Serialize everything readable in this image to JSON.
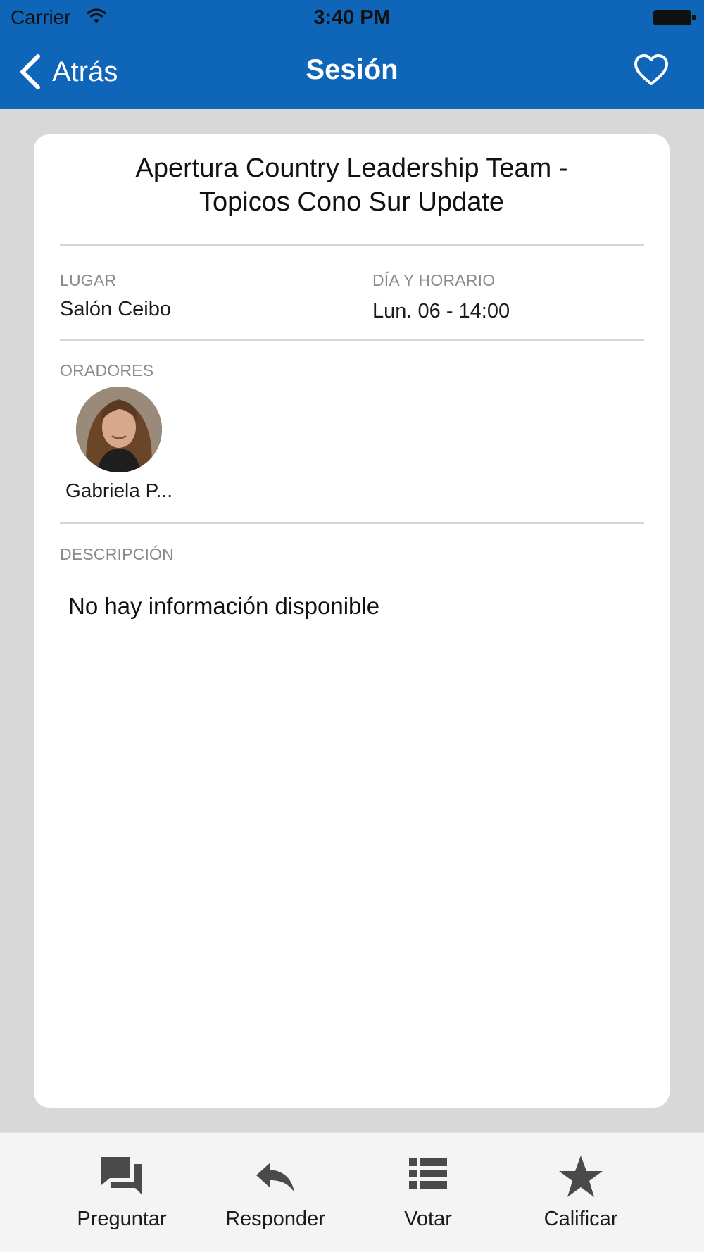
{
  "status_bar": {
    "carrier": "Carrier",
    "time": "3:40 PM"
  },
  "nav": {
    "back_label": "Atrás",
    "title": "Sesión"
  },
  "session": {
    "title_line1": "Apertura Country Leadership Team -",
    "title_line2": "Topicos Cono Sur Update",
    "location_label": "LUGAR",
    "location_value": "Salón Ceibo",
    "datetime_label": "DÍA Y HORARIO",
    "datetime_value": "Lun. 06 - 14:00",
    "speakers_label": "ORADORES",
    "speakers": [
      {
        "name": "Gabriela P..."
      }
    ],
    "description_label": "DESCRIPCIÓN",
    "description_value": "No hay información disponible"
  },
  "tabbar": {
    "tabs": [
      {
        "label": "Preguntar",
        "icon": "chat-bubbles-icon"
      },
      {
        "label": "Responder",
        "icon": "reply-icon"
      },
      {
        "label": "Votar",
        "icon": "list-icon"
      },
      {
        "label": "Calificar",
        "icon": "star-icon"
      }
    ]
  },
  "colors": {
    "nav_background": "#0f66b8",
    "page_background": "#d8d8d8",
    "card_background": "#ffffff",
    "tabbar_background": "#f4f4f4",
    "icon_gray": "#4a4a4a"
  }
}
